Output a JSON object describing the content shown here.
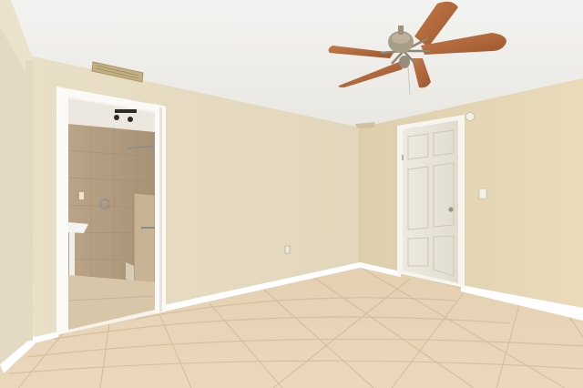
{
  "scene": {
    "subject": "empty-room-interior",
    "colors": {
      "ceiling": "#f1f0ec",
      "wall_left": "#e6dcc3",
      "wall_back": "#e3d8bd",
      "wall_right": "#e6d7b5",
      "floor": "#e8d4b7",
      "floor_grout": "#cdb597",
      "baseboard": "#ffffff",
      "door_panel": "#ece7db",
      "door_frame": "#f4f1ea",
      "fan_blade": "#b56a3d",
      "fan_metal": "#a39986",
      "bath_tile": "#bda98c",
      "vent": "#c8b78d"
    },
    "objects": [
      {
        "name": "ceiling-fan",
        "blades": 5
      },
      {
        "name": "bathroom-doorway",
        "state": "open"
      },
      {
        "name": "closet-door",
        "state": "closed",
        "panels": 6
      },
      {
        "name": "ceiling-vent"
      },
      {
        "name": "light-switch"
      },
      {
        "name": "wall-outlet"
      },
      {
        "name": "tile-floor"
      }
    ]
  }
}
